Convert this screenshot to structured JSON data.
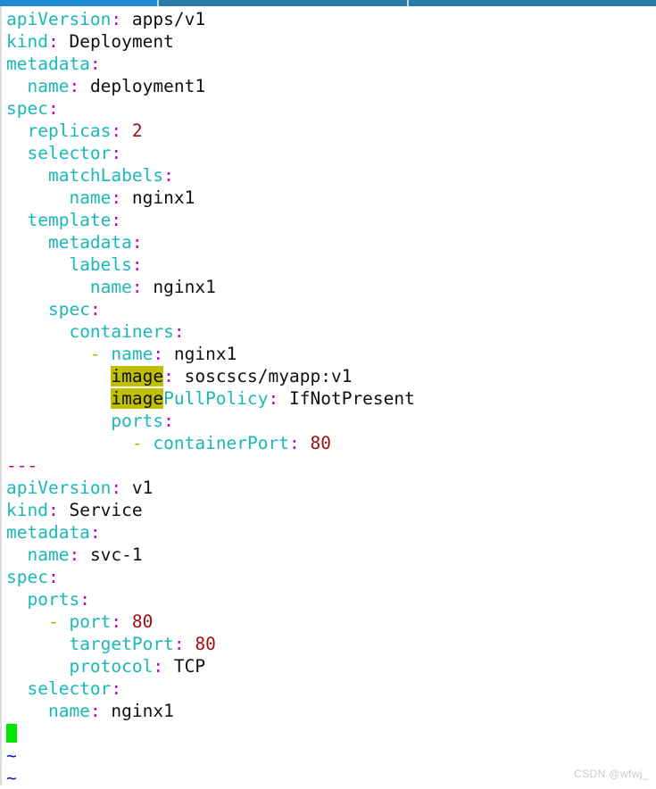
{
  "window": {
    "topbar": {
      "active_color": "#1e8bd8",
      "rest_color": "#2b7ca8"
    }
  },
  "editor": {
    "background_color": "#ffffff",
    "key_color": "#1ab8b8",
    "colon_color": "#c000c0",
    "value_color": "#101010",
    "number_color": "#a01010",
    "dash_color": "#b5b500",
    "highlight_color": "#c0c000",
    "cursor_color": "#00e800",
    "tilde_color": "#1010d0",
    "lines": [
      {
        "indent": "",
        "key": "apiVersion",
        "colon": ":",
        "value": " apps/v1",
        "type": "pair"
      },
      {
        "indent": "",
        "key": "kind",
        "colon": ":",
        "value": " Deployment",
        "type": "pair"
      },
      {
        "indent": "",
        "key": "metadata",
        "colon": ":",
        "value": "",
        "type": "pair"
      },
      {
        "indent": "  ",
        "key": "name",
        "colon": ":",
        "value": " deployment1",
        "type": "pair"
      },
      {
        "indent": "",
        "key": "spec",
        "colon": ":",
        "value": "",
        "type": "pair"
      },
      {
        "indent": "  ",
        "key": "replicas",
        "colon": ":",
        "value": " 2",
        "type": "number"
      },
      {
        "indent": "  ",
        "key": "selector",
        "colon": ":",
        "value": "",
        "type": "pair"
      },
      {
        "indent": "    ",
        "key": "matchLabels",
        "colon": ":",
        "value": "",
        "type": "pair"
      },
      {
        "indent": "      ",
        "key": "name",
        "colon": ":",
        "value": " nginx1",
        "type": "pair"
      },
      {
        "indent": "  ",
        "key": "template",
        "colon": ":",
        "value": "",
        "type": "pair"
      },
      {
        "indent": "    ",
        "key": "metadata",
        "colon": ":",
        "value": "",
        "type": "pair"
      },
      {
        "indent": "      ",
        "key": "labels",
        "colon": ":",
        "value": "",
        "type": "pair"
      },
      {
        "indent": "        ",
        "key": "name",
        "colon": ":",
        "value": " nginx1",
        "type": "pair"
      },
      {
        "indent": "    ",
        "key": "spec",
        "colon": ":",
        "value": "",
        "type": "pair"
      },
      {
        "indent": "      ",
        "key": "containers",
        "colon": ":",
        "value": "",
        "type": "pair"
      },
      {
        "indent": "        ",
        "dash": "- ",
        "key": "name",
        "colon": ":",
        "value": " nginx1",
        "type": "dash-pair"
      },
      {
        "indent": "          ",
        "key": "image",
        "colon": ":",
        "value": " soscscs/myapp:v1",
        "type": "highlight-pair",
        "highlight": "image"
      },
      {
        "indent": "          ",
        "key": "imagePullPolicy",
        "colon": ":",
        "value": " IfNotPresent",
        "type": "highlight-split-pair",
        "highlight": "image",
        "rest_key": "PullPolicy"
      },
      {
        "indent": "          ",
        "key": "ports",
        "colon": ":",
        "value": "",
        "type": "pair"
      },
      {
        "indent": "            ",
        "dash": "- ",
        "key": "containerPort",
        "colon": ":",
        "value": " 80",
        "type": "dash-number"
      },
      {
        "indent": "",
        "text": "---",
        "type": "separator"
      },
      {
        "indent": "",
        "key": "apiVersion",
        "colon": ":",
        "value": " v1",
        "type": "pair"
      },
      {
        "indent": "",
        "key": "kind",
        "colon": ":",
        "value": " Service",
        "type": "pair"
      },
      {
        "indent": "",
        "key": "metadata",
        "colon": ":",
        "value": "",
        "type": "pair"
      },
      {
        "indent": "  ",
        "key": "name",
        "colon": ":",
        "value": " svc-1",
        "type": "pair"
      },
      {
        "indent": "",
        "key": "spec",
        "colon": ":",
        "value": "",
        "type": "pair"
      },
      {
        "indent": "  ",
        "key": "ports",
        "colon": ":",
        "value": "",
        "type": "pair"
      },
      {
        "indent": "    ",
        "dash": "- ",
        "key": "port",
        "colon": ":",
        "value": " 80",
        "type": "dash-number"
      },
      {
        "indent": "      ",
        "key": "targetPort",
        "colon": ":",
        "value": " 80",
        "type": "number"
      },
      {
        "indent": "      ",
        "key": "protocol",
        "colon": ":",
        "value": " TCP",
        "type": "pair"
      },
      {
        "indent": "  ",
        "key": "selector",
        "colon": ":",
        "value": "",
        "type": "pair"
      },
      {
        "indent": "    ",
        "key": "name",
        "colon": ":",
        "value": " nginx1",
        "type": "pair"
      },
      {
        "type": "cursor"
      },
      {
        "type": "tilde",
        "text": "~"
      },
      {
        "type": "tilde",
        "text": "~"
      }
    ]
  },
  "watermark": {
    "text": "CSDN @wfwj_"
  }
}
